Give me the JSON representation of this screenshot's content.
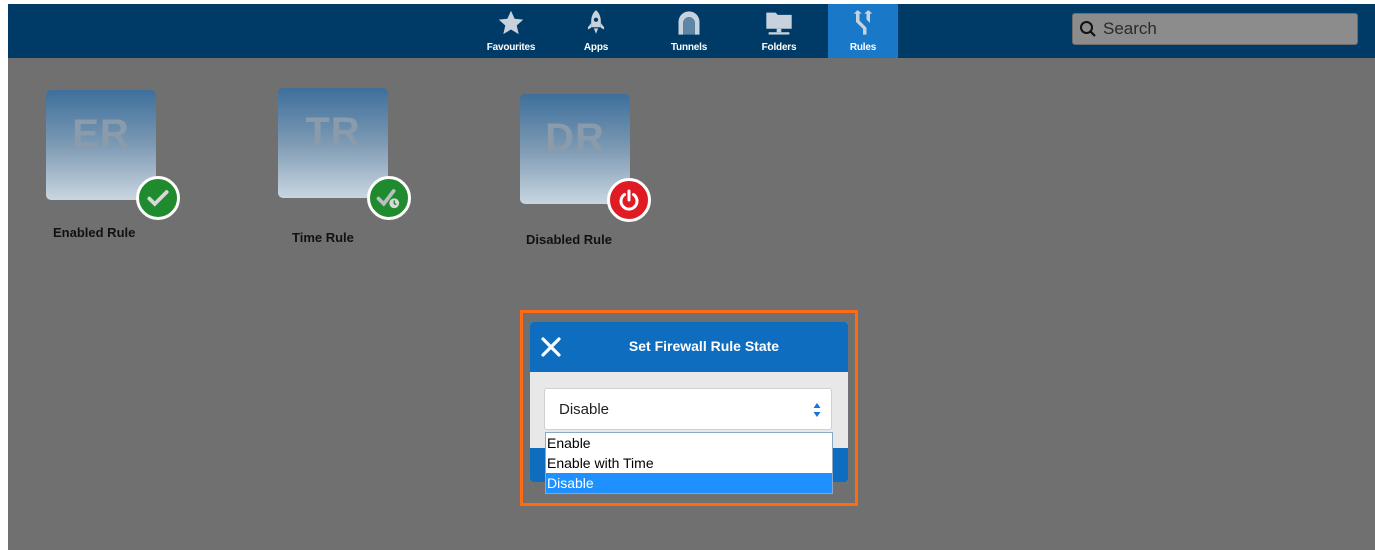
{
  "nav": {
    "tabs": [
      {
        "label": "Favourites",
        "icon": "star-icon",
        "active": false
      },
      {
        "label": "Apps",
        "icon": "rocket-icon",
        "active": false
      },
      {
        "label": "Tunnels",
        "icon": "tunnel-icon",
        "active": false
      },
      {
        "label": "Folders",
        "icon": "folder-icon",
        "active": false
      },
      {
        "label": "Rules",
        "icon": "rules-icon",
        "active": true
      }
    ]
  },
  "search": {
    "placeholder": "Search"
  },
  "rules": [
    {
      "abbr": "ER",
      "label": "Enabled Rule",
      "status": "enabled",
      "badge_color": "#1f8a2e"
    },
    {
      "abbr": "TR",
      "label": "Time Rule",
      "status": "time",
      "badge_color": "#1f8a2e"
    },
    {
      "abbr": "DR",
      "label": "Disabled Rule",
      "status": "disabled",
      "badge_color": "#e01b24"
    }
  ],
  "dialog": {
    "title": "Set Firewall Rule State",
    "selected": "Disable",
    "options": [
      "Enable",
      "Enable with Time",
      "Disable"
    ],
    "highlight_color": "#ff6a13"
  },
  "colors": {
    "topbar": "#003a66",
    "active_tab": "#1a78c8",
    "background": "#707070"
  }
}
